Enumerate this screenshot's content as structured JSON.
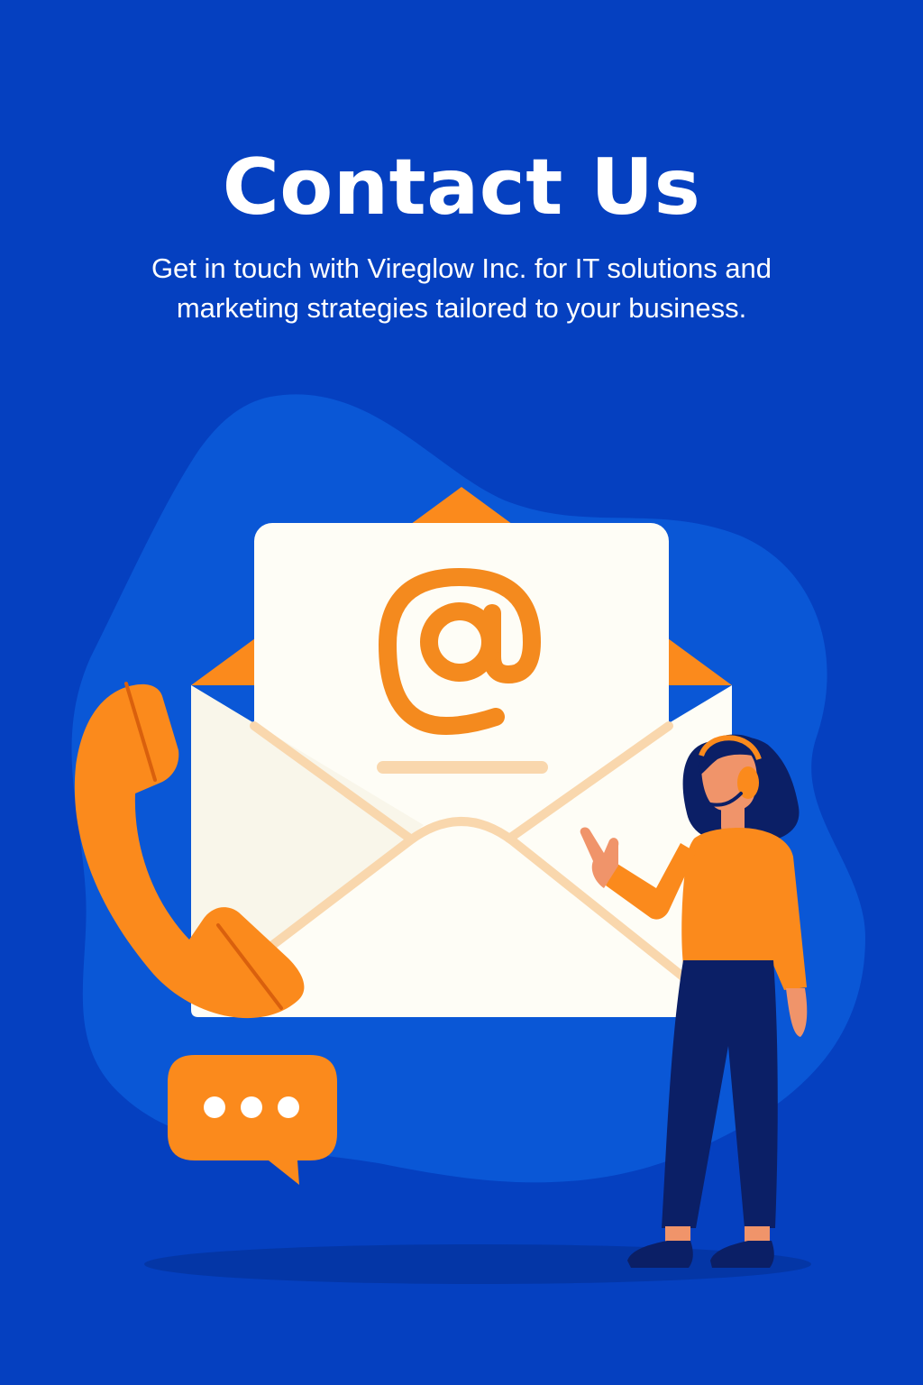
{
  "page": {
    "title": "Contact Us",
    "subtitle": "Get in touch with Vireglow Inc. for IT solutions and marketing strategies tailored to your business."
  },
  "illustration": {
    "letter_symbol": "@",
    "icons": [
      "envelope-icon",
      "at-sign-icon",
      "phone-handset-icon",
      "chat-bubble-icon",
      "support-agent-figure"
    ]
  },
  "colors": {
    "background": "#0540c0",
    "blob": "#0a57d6",
    "accent_orange": "#fb8a1c",
    "paper": "#fefdf6",
    "navy": "#0b1f66"
  }
}
